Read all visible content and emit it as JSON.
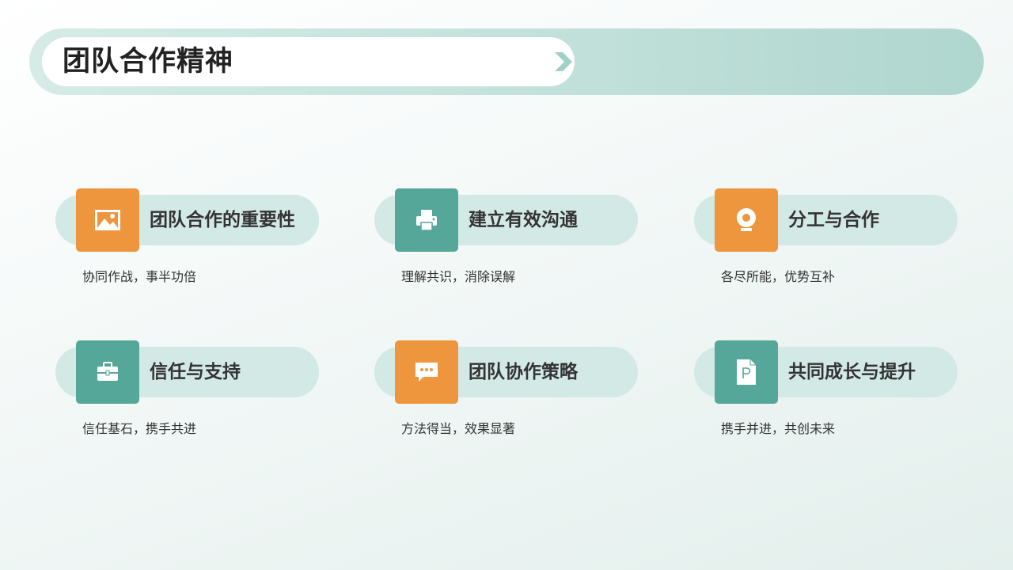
{
  "page": {
    "title": "团队合作精神"
  },
  "colors": {
    "orange": "#ee963e",
    "teal": "#55a799",
    "pill": "#d3e9e5",
    "title_band": "#b8dcd5",
    "chevron": "#9fd1c6"
  },
  "cards": [
    {
      "title": "团队合作的重要性",
      "desc": "协同作战，事半功倍",
      "icon": "image-icon",
      "color": "orange"
    },
    {
      "title": "建立有效沟通",
      "desc": "理解共识，消除误解",
      "icon": "printer-icon",
      "color": "teal"
    },
    {
      "title": "分工与合作",
      "desc": "各尽所能，优势互补",
      "icon": "webcam-icon",
      "color": "orange"
    },
    {
      "title": "信任与支持",
      "desc": "信任基石，携手共进",
      "icon": "briefcase-icon",
      "color": "teal"
    },
    {
      "title": "团队协作策略",
      "desc": "方法得当，效果显著",
      "icon": "chat-bubble-icon",
      "color": "orange"
    },
    {
      "title": "共同成长与提升",
      "desc": "携手并进，共创未来",
      "icon": "document-p-icon",
      "color": "teal"
    }
  ]
}
